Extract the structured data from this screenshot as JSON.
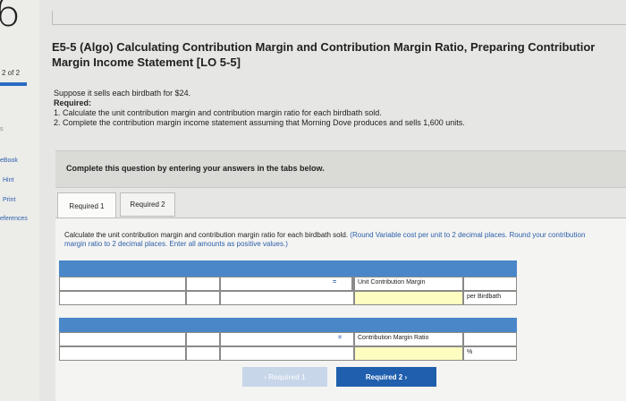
{
  "rail": {
    "big_digit": "6",
    "page_indicator": "2 of 2",
    "s_label": "s",
    "items": [
      "eBook",
      "Hint",
      "Print",
      "eferences"
    ]
  },
  "title": {
    "line1": "E5-5 (Algo) Calculating Contribution Margin and Contribution Margin Ratio, Preparing Contributior",
    "line2": "Margin Income Statement [LO 5-5]"
  },
  "problem": {
    "intro": "Suppose it sells each birdbath for $24.",
    "required_label": "Required:",
    "req1": "1. Calculate the unit contribution margin and contribution margin ratio for each birdbath sold.",
    "req2": "2. Complete the contribution margin income statement assuming that Morning Dove produces and sells 1,600 units."
  },
  "instructions": "Complete this question by entering your answers in the tabs below.",
  "tabs": [
    "Required 1",
    "Required 2"
  ],
  "panel": {
    "instr_main": "Calculate the unit contribution margin and contribution margin ratio for each birdbath sold. ",
    "instr_hint": "(Round Variable cost per unit to 2 decimal places. Round your contribution margin ratio to 2 decimal places. Enter all amounts as positive values.)",
    "table1": {
      "equals": "=",
      "result_label": "Unit Contribution Margin",
      "unit": "per Birdbath"
    },
    "table2": {
      "equals": "=",
      "result_label": "Contribution Margin Ratio",
      "unit": "%"
    }
  },
  "nav": {
    "prev": "‹  Required 1",
    "next": "Required 2  ›"
  }
}
